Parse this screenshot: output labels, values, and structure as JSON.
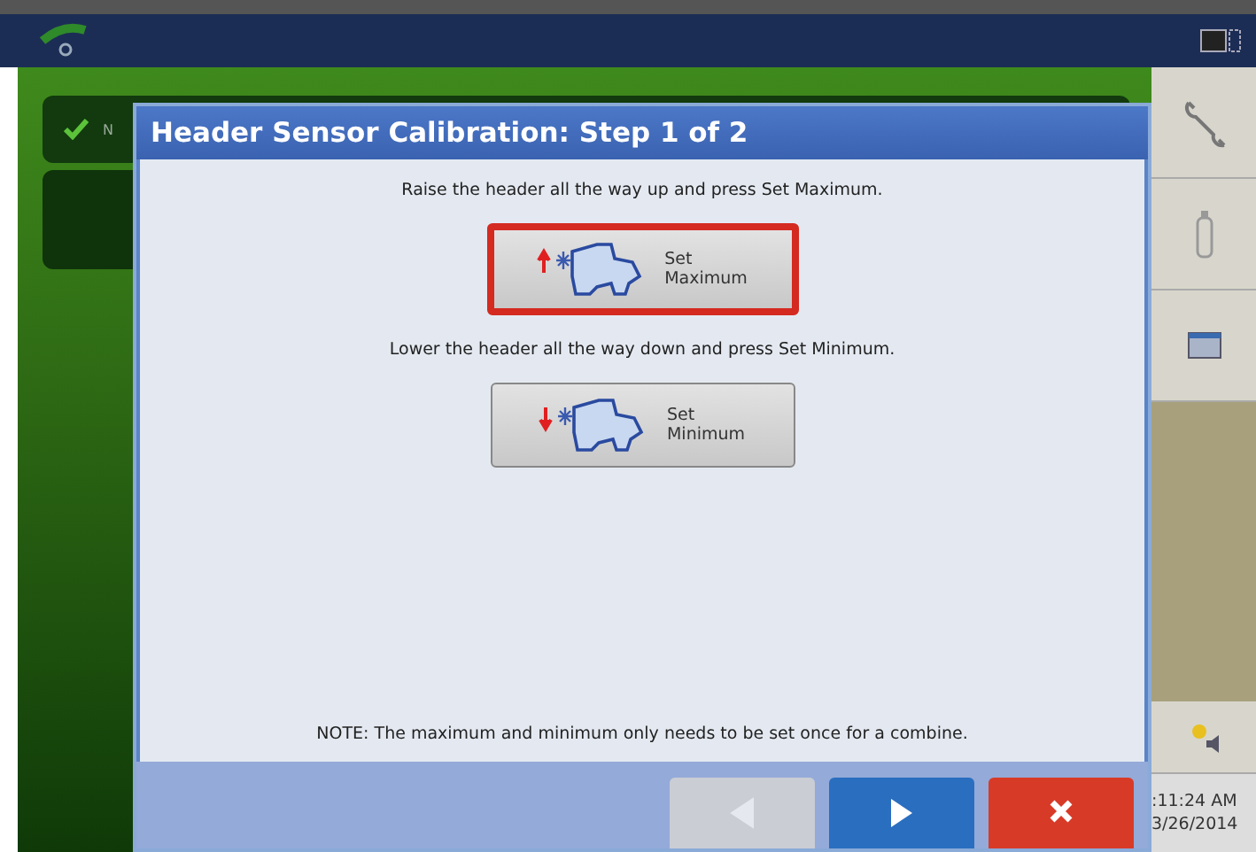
{
  "background_panel": {
    "items": [
      {
        "label": "N"
      }
    ]
  },
  "dialog": {
    "title": "Header Sensor Calibration:  Step 1 of 2",
    "steps": [
      {
        "instruction": "Raise the header all the way up and press Set Maximum.",
        "button": {
          "label": "Set\nMaximum",
          "kind": "raise",
          "selected": true
        }
      },
      {
        "instruction": "Lower the header all the way down and press Set Minimum.",
        "button": {
          "label": "Set\nMinimum",
          "kind": "lower",
          "selected": false
        }
      }
    ],
    "note": "NOTE:  The maximum and minimum only needs to be set once for a combine.",
    "footer_buttons": [
      {
        "kind": "back",
        "disabled": true
      },
      {
        "kind": "next",
        "disabled": false
      },
      {
        "kind": "cancel",
        "disabled": false
      }
    ]
  },
  "status": {
    "time": ":11:24 AM",
    "date": "3/26/2014"
  }
}
